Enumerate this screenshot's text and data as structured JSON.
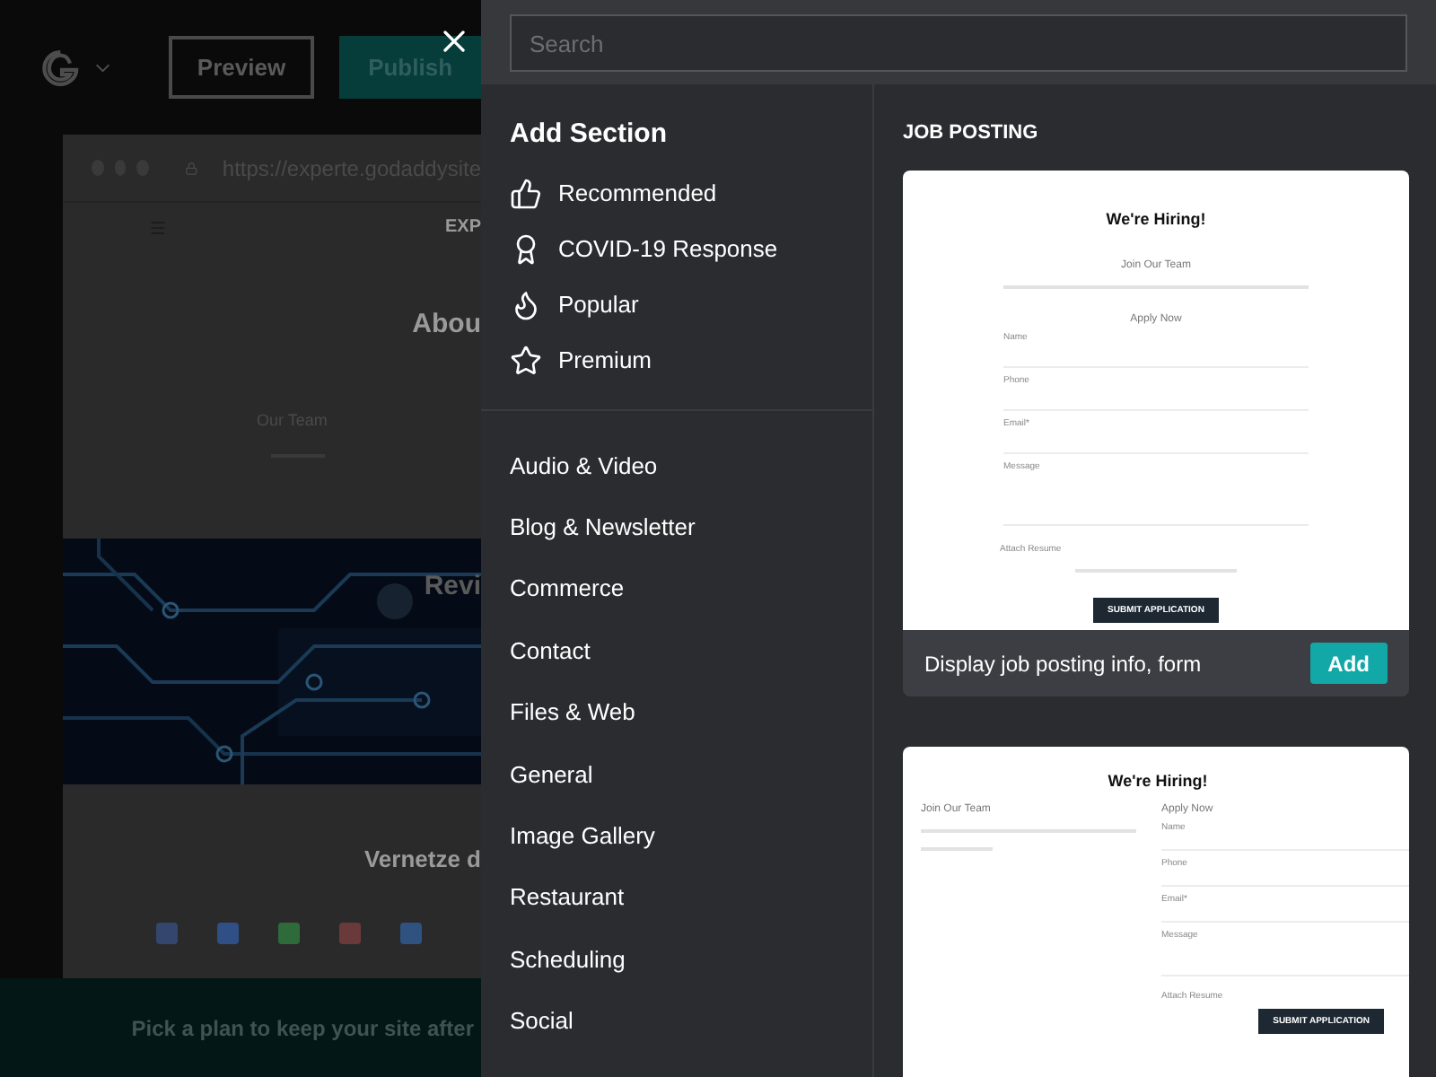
{
  "editor": {
    "buttons": [
      {
        "label": "Preview",
        "kind": "outline"
      },
      {
        "label": "Publish",
        "kind": "filled"
      }
    ],
    "url": "https://experte.godaddysite",
    "site": {
      "brand": "EXP",
      "heading": "Abou",
      "team": "Our Team",
      "banner_heading": "Revi",
      "connect_heading": "Vernetze d"
    },
    "plan_bar": "Pick a plan to keep your site after"
  },
  "panel": {
    "search": {
      "placeholder": "Search"
    },
    "title": "Add Section",
    "featured": [
      {
        "label": "Recommended",
        "kind": "thumbs"
      },
      {
        "label": "COVID-19 Response",
        "kind": "ribbon"
      },
      {
        "label": "Popular",
        "kind": "flame"
      },
      {
        "label": "Premium",
        "kind": "star"
      }
    ],
    "categories": [
      "Audio & Video",
      "Blog & Newsletter",
      "Commerce",
      "Contact",
      "Files & Web",
      "General",
      "Image Gallery",
      "Restaurant",
      "Scheduling",
      "Social"
    ],
    "group_title": "JOB POSTING",
    "templates": [
      {
        "kind": "stacked",
        "title": "We're Hiring!",
        "subtitle": "Join Our Team",
        "form_title": "Apply Now",
        "fields": [
          "Name",
          "Phone",
          "Email*",
          "Message"
        ],
        "attach": "Attach Resume",
        "submit": "SUBMIT APPLICATION",
        "description": "Display job posting info, form",
        "add": "Add"
      },
      {
        "kind": "columns",
        "title": "We're Hiring!",
        "subtitle": "Join Our Team",
        "form_title": "Apply Now",
        "fields": [
          "Name",
          "Phone",
          "Email*",
          "Message"
        ],
        "attach": "Attach Resume",
        "submit": "SUBMIT APPLICATION"
      }
    ]
  }
}
